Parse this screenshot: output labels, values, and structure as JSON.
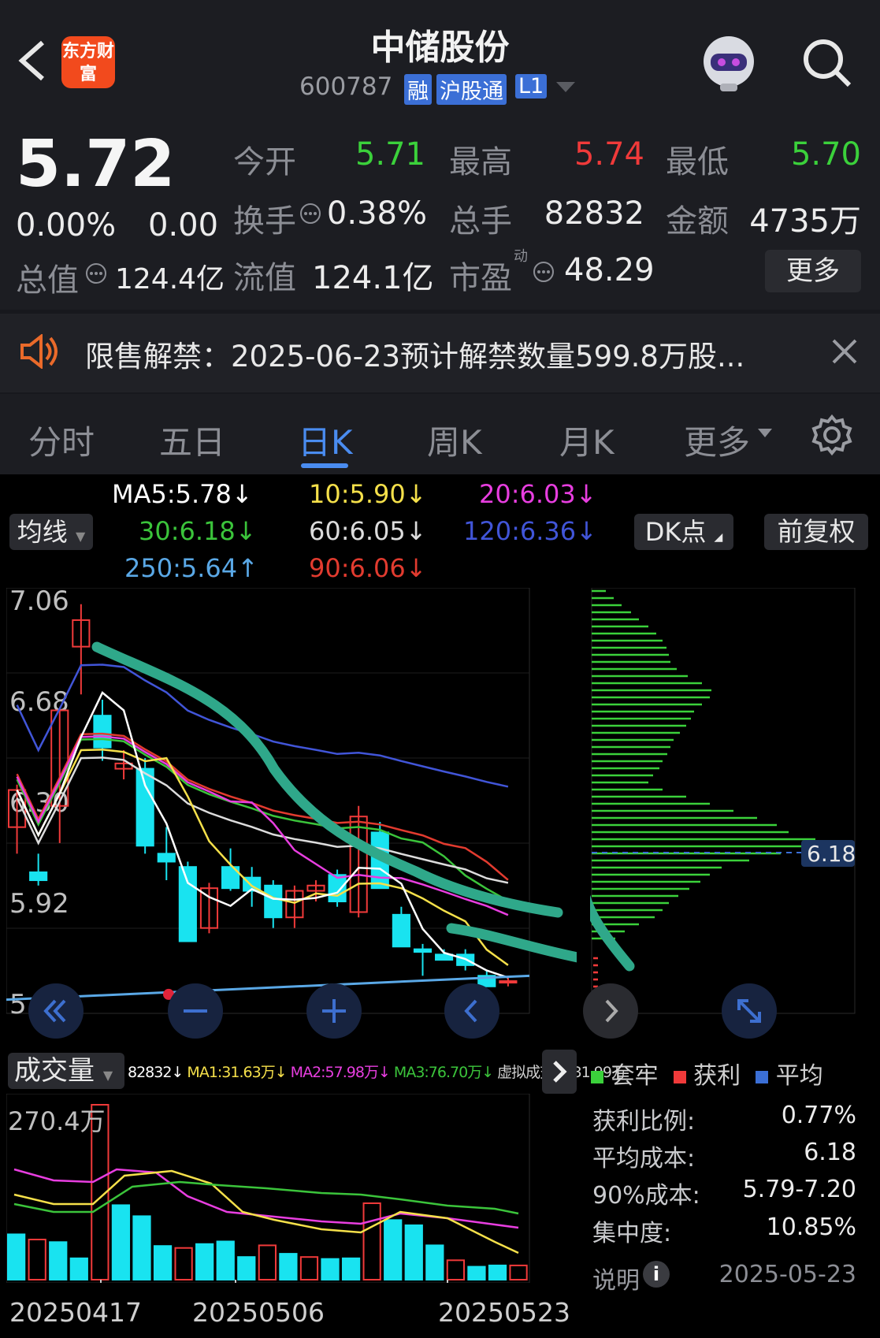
{
  "header": {
    "title": "中储股份",
    "code": "600787",
    "badges": [
      "融",
      "沪股通",
      "L1"
    ],
    "logo_text": "东方财富"
  },
  "quote": {
    "price": "5.72",
    "change_pct": "0.00%",
    "change": "0.00",
    "open_label": "今开",
    "open": "5.71",
    "high_label": "最高",
    "high": "5.74",
    "low_label": "最低",
    "low": "5.70",
    "turnover_label": "换手",
    "turnover": "0.38%",
    "volume_label": "总手",
    "volume": "82832",
    "amount_label": "金额",
    "amount": "4735万",
    "mktcap_label": "总值",
    "mktcap": "124.4亿",
    "float_label": "流值",
    "float": "124.1亿",
    "pe_label": "市盈",
    "pe_sup": "动",
    "pe": "48.29",
    "more": "更多"
  },
  "notice": {
    "text": "限售解禁：2025-06-23预计解禁数量599.8万股..."
  },
  "tabs": [
    "分时",
    "五日",
    "日K",
    "周K",
    "月K",
    "更多"
  ],
  "active_tab": "日K",
  "ma_legend": {
    "ma5": "MA5:5.78↓",
    "ma10": "10:5.90↓",
    "ma20": "20:6.03↓",
    "ma30": "30:6.18↓",
    "ma60": "60:6.05↓",
    "ma120": "120:6.36↓",
    "ma250": "250:5.64↑",
    "ma90": "90:6.06↓"
  },
  "controls": {
    "avg_line": "均线",
    "dk": "DK点",
    "fq": "前复权"
  },
  "price_axis": [
    "7.06",
    "6.68",
    "6.30",
    "5.92",
    "5.54"
  ],
  "chip": {
    "avg_cost_tag": "6.18",
    "legend": [
      "套牢",
      "获利",
      "平均"
    ],
    "stats": [
      {
        "label": "获利比例:",
        "value": "0.77%"
      },
      {
        "label": "平均成本:",
        "value": "6.18"
      },
      {
        "label": "90%成本:",
        "value": "5.79-7.20"
      },
      {
        "label": "集中度:",
        "value": "10.85%"
      }
    ],
    "explain": "说明",
    "date": "2025-05-23"
  },
  "volume": {
    "label": "成交量",
    "legend": {
      "vol": "82832↓",
      "ma1": "MA1:31.63万↓",
      "ma2": "MA2:57.98万↓",
      "ma3": "MA3:76.70万↓",
      "virtual": "虚拟成交量:31.99万"
    },
    "max": "270.4万"
  },
  "dates": [
    "20250417",
    "20250506",
    "20250523"
  ],
  "colors": {
    "up": "#f03a3a",
    "down": "#19e3f0",
    "ma5": "#ffffff",
    "ma10": "#f5e04a",
    "ma20": "#e83ee0",
    "ma30": "#3bc43b",
    "ma60": "#dcdcdc",
    "ma90": "#e23b2f",
    "ma120": "#4155d8",
    "ma250": "#5aa8e6",
    "annotation": "#2fa88a"
  },
  "chart_data": {
    "type": "candlestick",
    "candles": [
      {
        "o": 6.2,
        "h": 6.36,
        "l": 6.1,
        "c": 6.34
      },
      {
        "o": 6.03,
        "h": 6.1,
        "l": 5.98,
        "c": 6.0
      },
      {
        "o": 6.28,
        "h": 6.64,
        "l": 6.14,
        "c": 6.64
      },
      {
        "o": 6.88,
        "h": 7.04,
        "l": 6.7,
        "c": 6.98
      },
      {
        "o": 6.62,
        "h": 6.68,
        "l": 6.45,
        "c": 6.5
      },
      {
        "o": 6.42,
        "h": 6.49,
        "l": 6.38,
        "c": 6.44
      },
      {
        "o": 6.42,
        "h": 6.46,
        "l": 6.1,
        "c": 6.13
      },
      {
        "o": 6.1,
        "h": 6.2,
        "l": 6.0,
        "c": 6.07
      },
      {
        "o": 6.05,
        "h": 6.07,
        "l": 5.78,
        "c": 5.77
      },
      {
        "o": 5.82,
        "h": 5.99,
        "l": 5.8,
        "c": 5.97
      },
      {
        "o": 6.05,
        "h": 6.12,
        "l": 5.96,
        "c": 5.97
      },
      {
        "o": 6.01,
        "h": 6.05,
        "l": 5.9,
        "c": 5.96
      },
      {
        "o": 5.98,
        "h": 6.0,
        "l": 5.82,
        "c": 5.86
      },
      {
        "o": 5.86,
        "h": 5.98,
        "l": 5.82,
        "c": 5.96
      },
      {
        "o": 5.96,
        "h": 6.0,
        "l": 5.92,
        "c": 5.98
      },
      {
        "o": 6.02,
        "h": 6.04,
        "l": 5.9,
        "c": 5.92
      },
      {
        "o": 5.88,
        "h": 6.28,
        "l": 5.86,
        "c": 6.24
      },
      {
        "o": 6.18,
        "h": 6.22,
        "l": 5.97,
        "c": 5.97
      },
      {
        "o": 5.87,
        "h": 5.9,
        "l": 5.75,
        "c": 5.75
      },
      {
        "o": 5.74,
        "h": 5.76,
        "l": 5.64,
        "c": 5.73
      },
      {
        "o": 5.72,
        "h": 5.74,
        "l": 5.7,
        "c": 5.7
      },
      {
        "o": 5.72,
        "h": 5.74,
        "l": 5.66,
        "c": 5.68
      },
      {
        "o": 5.64,
        "h": 5.66,
        "l": 5.6,
        "c": 5.6
      },
      {
        "o": 5.62,
        "h": 5.64,
        "l": 5.6,
        "c": 5.62
      }
    ],
    "volumes": [
      70,
      62,
      58,
      33,
      270,
      115,
      98,
      52,
      49,
      55,
      59,
      35,
      53,
      40,
      35,
      32,
      33,
      118,
      92,
      84,
      53,
      30,
      20,
      22,
      22
    ],
    "ylim": [
      5.54,
      7.06
    ]
  }
}
